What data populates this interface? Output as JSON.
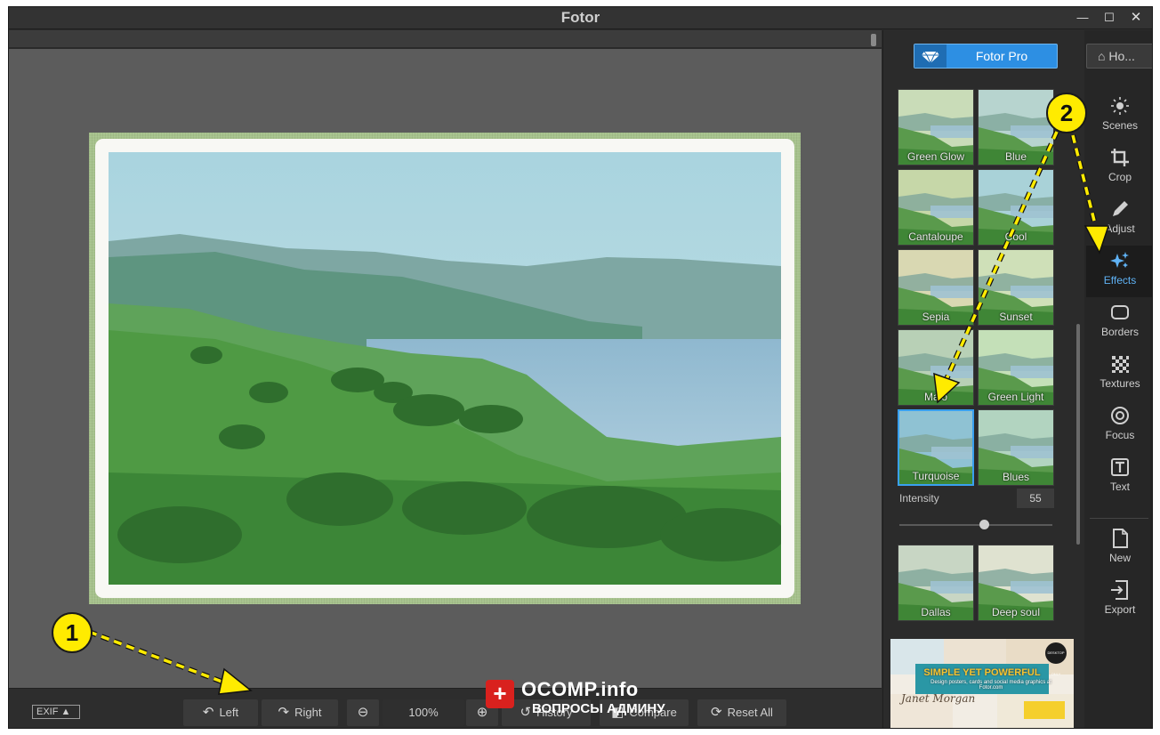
{
  "window": {
    "title": "Fotor",
    "controls": {
      "minimize": "—",
      "maximize": "☐",
      "close": "✕"
    }
  },
  "bottombar": {
    "exif": "EXIF ▲",
    "rotate_left": "Left",
    "rotate_right": "Right",
    "zoom": "100%",
    "history": "History",
    "compare": "Compare",
    "reset": "Reset  All"
  },
  "watermark": {
    "title": "OCOMP.info",
    "subtitle": "ВОПРОСЫ АДМИНУ",
    "badge": "+"
  },
  "panel": {
    "pro_label": "Fotor Pro",
    "effects": [
      {
        "label": "Green Glow"
      },
      {
        "label": "Blue"
      },
      {
        "label": "Cantaloupe"
      },
      {
        "label": "Cool"
      },
      {
        "label": "Sepia"
      },
      {
        "label": "Sunset"
      },
      {
        "label": "Malo"
      },
      {
        "label": "Green Light"
      },
      {
        "label": "Turquoise"
      },
      {
        "label": "Blues"
      }
    ],
    "selected_effect": "Turquoise",
    "intensity_label": "Intensity",
    "intensity_value": "55",
    "intensity_fraction": 0.55,
    "effects_more": [
      {
        "label": "Dallas"
      },
      {
        "label": "Deep soul"
      }
    ],
    "ad": {
      "headline": "SIMPLE YET POWERFUL",
      "sub": "Design posters, cards and social media graphics at Fotor.com",
      "script": "Janet Morgan",
      "badge": "DESKTOP ONLY"
    }
  },
  "toolbar": {
    "home": "Ho...",
    "tools": [
      {
        "label": "Scenes",
        "icon": "sun-icon"
      },
      {
        "label": "Crop",
        "icon": "crop-icon"
      },
      {
        "label": "Adjust",
        "icon": "pencil-icon"
      },
      {
        "label": "Effects",
        "icon": "sparkles-icon"
      },
      {
        "label": "Borders",
        "icon": "rounded-rect-icon"
      },
      {
        "label": "Textures",
        "icon": "checker-icon"
      },
      {
        "label": "Focus",
        "icon": "target-icon"
      },
      {
        "label": "Text",
        "icon": "text-t-icon"
      }
    ],
    "file_tools": [
      {
        "label": "New",
        "icon": "file-icon"
      },
      {
        "label": "Export",
        "icon": "export-icon"
      }
    ],
    "active_tool": "Effects"
  },
  "annotations": {
    "marker1": "1",
    "marker2": "2"
  },
  "colors": {
    "accent": "#2d8fe3",
    "active_text": "#5fb2f5",
    "marker": "#ffeb00"
  }
}
